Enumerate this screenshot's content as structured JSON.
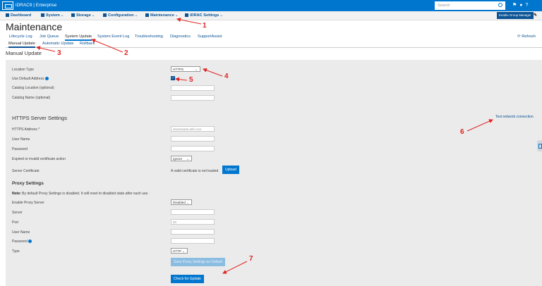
{
  "topbar": {
    "title": "iDRAC9 | Enterprise",
    "search_placeholder": "Search",
    "icons": [
      "notifications-icon",
      "user-icon",
      "help-icon"
    ]
  },
  "navbar": {
    "dashboard": "Dashboard",
    "system": "System",
    "storage": "Storage",
    "configuration": "Configuration",
    "maintenance": "Maintenance",
    "idrac_settings": "iDRAC Settings",
    "enable_group_manager": "Enable Group Manager"
  },
  "page": {
    "title": "Maintenance",
    "refresh": "Refresh"
  },
  "tabs": [
    {
      "label": "Lifecycle Log"
    },
    {
      "label": "Job Queue"
    },
    {
      "label": "System Update"
    },
    {
      "label": "System Event Log"
    },
    {
      "label": "Troubleshooting"
    },
    {
      "label": "Diagnostics"
    },
    {
      "label": "SupportAssist"
    }
  ],
  "subtabs": [
    {
      "label": "Manual Update"
    },
    {
      "label": "Automatic Update"
    },
    {
      "label": "Rollback"
    }
  ],
  "manual_update": {
    "heading": "Manual Update",
    "location_type_label": "Location Type",
    "location_type_value": "HTTPS",
    "use_default_address_label": "Use Default Address",
    "use_default_address_checked": true,
    "catalog_location_label": "Catalog Location (optional)",
    "catalog_name_label": "Catalog Name (optional)"
  },
  "https_settings": {
    "heading": "HTTPS Server Settings",
    "test_link": "Test network connection",
    "address_label": "HTTPS Address *",
    "address_placeholder": "downloads.dell.com",
    "username_label": "User Name",
    "password_label": "Password",
    "cert_action_label": "Expired or invalid certificate action",
    "cert_action_value": "Ignore",
    "server_cert_label": "Server Certificate",
    "server_cert_status": "A valid certificate is not loaded",
    "upload_button": "Upload"
  },
  "proxy": {
    "heading": "Proxy Settings",
    "note_bold": "Note:",
    "note_text": "By default Proxy Settings is disabled. It will reset to disabled state after each use.",
    "enable_label": "Enable Proxy Server",
    "enable_value": "Disabled",
    "server_label": "Server",
    "port_label": "Port",
    "port_value": "80",
    "username_label": "User Name",
    "password_label": "Password",
    "type_label": "Type",
    "type_value": "HTTP",
    "save_button": "Save Proxy Settings as Default"
  },
  "check_button": "Check for Update",
  "annotations": [
    "1",
    "2",
    "3",
    "4",
    "5",
    "6",
    "7"
  ],
  "colors": {
    "brand_blue": "#0076ce",
    "nav_text": "#0b5394",
    "annotation_red": "#e02424",
    "panel_bg": "#ebebeb"
  }
}
